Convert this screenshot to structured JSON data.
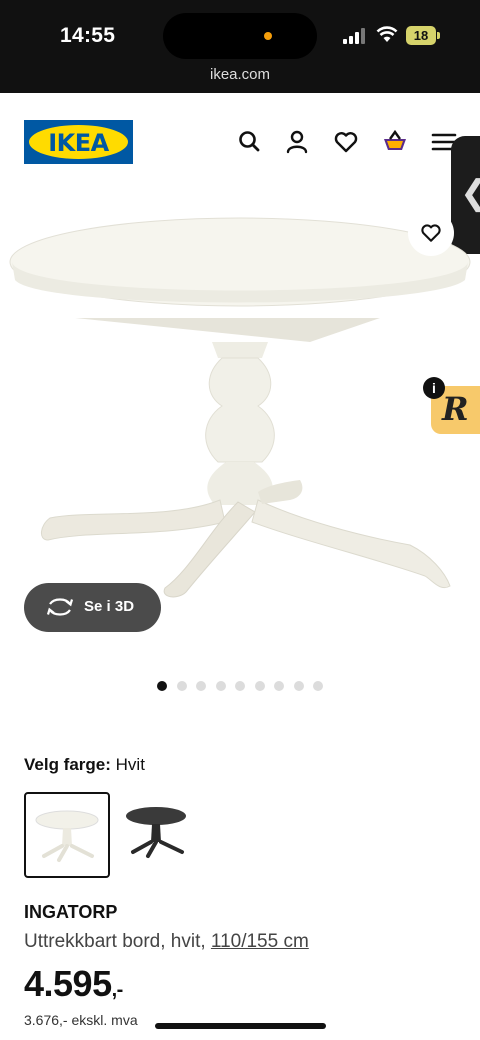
{
  "status_bar": {
    "time": "14:55",
    "battery": "18",
    "url": "ikea.com"
  },
  "header": {
    "logo_text": "IKEA",
    "icons": [
      "search-icon",
      "account-icon",
      "heart-icon",
      "cart-icon",
      "menu-icon"
    ]
  },
  "product": {
    "view_3d_label": "Se i 3D",
    "gallery_dots": 9,
    "active_dot": 0,
    "color_label": "Velg farge:",
    "color_value": "Hvit",
    "name": "INGATORP",
    "description": "Uttrekkbart bord, hvit,",
    "size": "110/155 cm",
    "price": "4.595",
    "price_suffix": ",-",
    "price_ex_vat": "3.676,- ekskl. mva"
  },
  "colors": {
    "ikea_blue": "#0058a3",
    "ikea_yellow": "#ffdb00",
    "badge": "#f7c96b"
  }
}
